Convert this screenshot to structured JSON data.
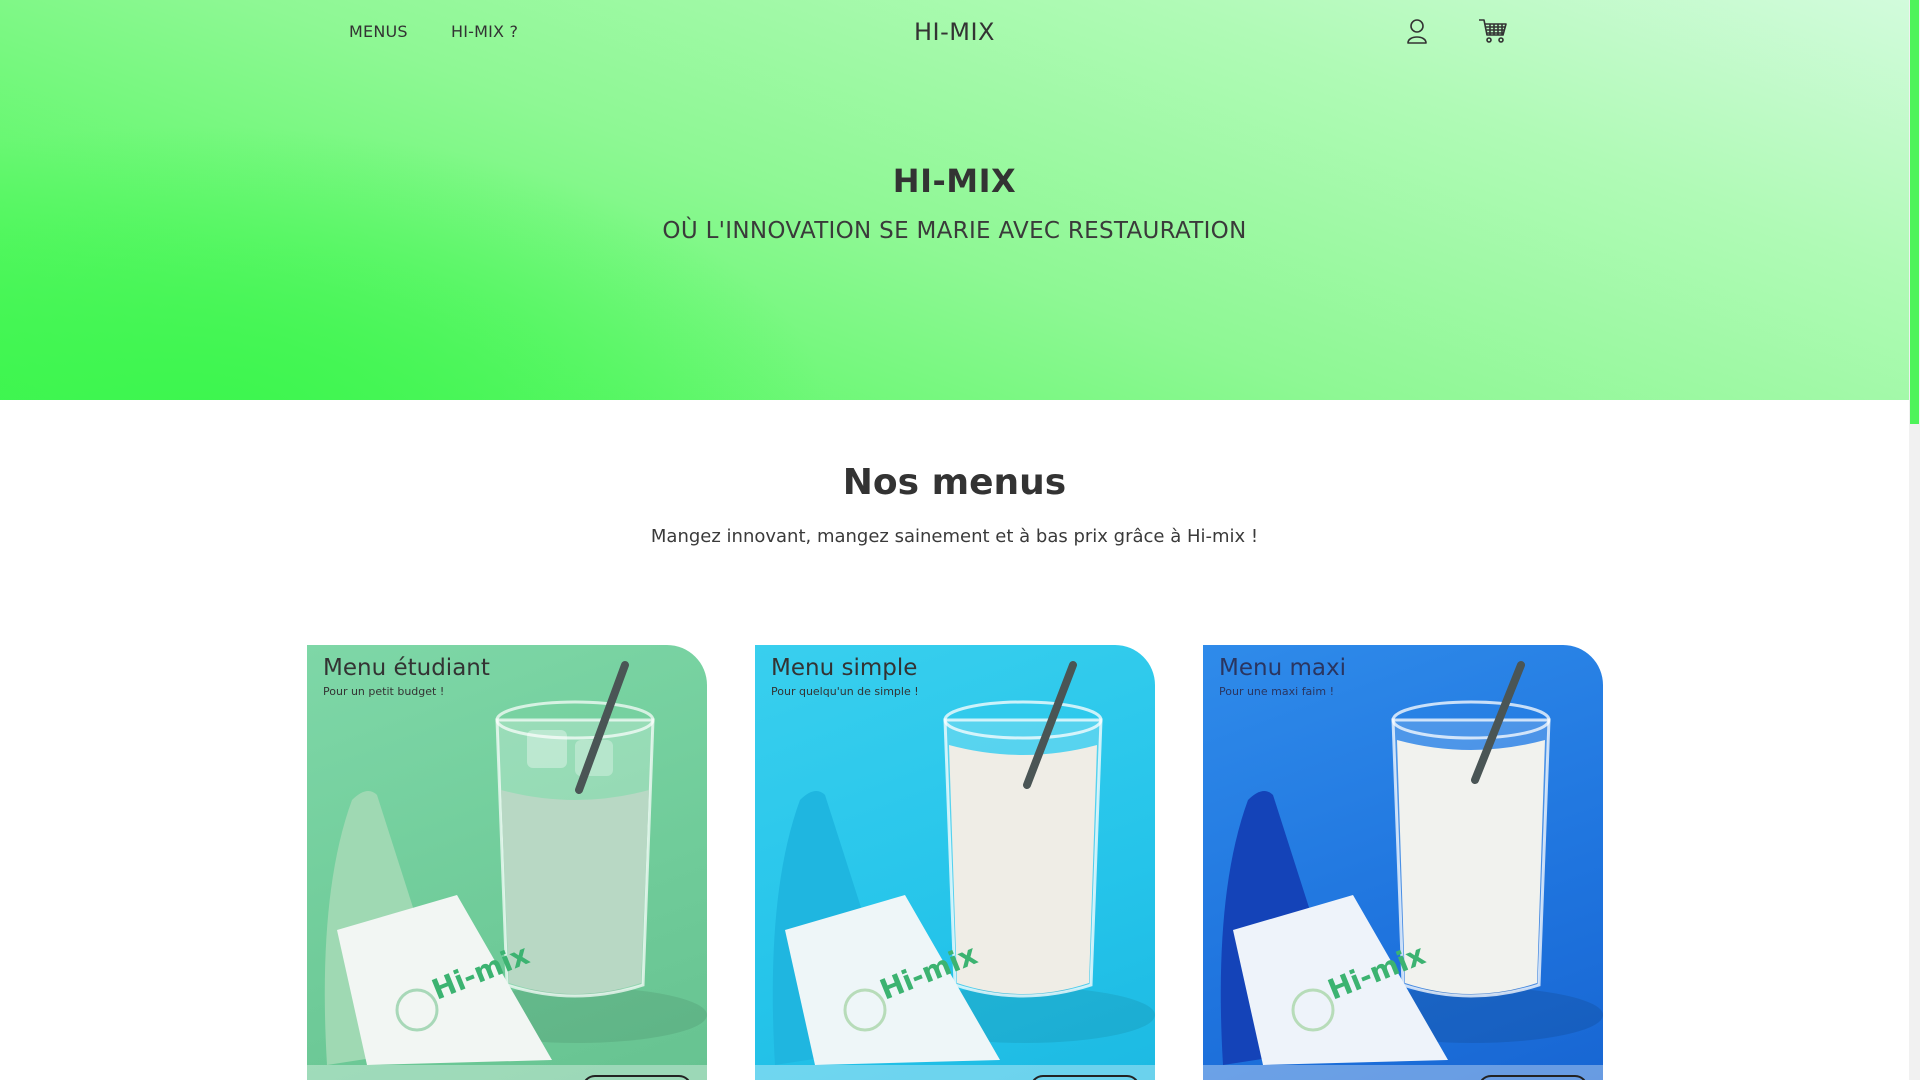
{
  "nav": {
    "links": [
      "MENUS",
      "HI-MIX ?"
    ],
    "brand": "HI-MIX",
    "icons": [
      "user-icon",
      "cart-icon"
    ]
  },
  "hero": {
    "title": "HI-MIX",
    "subtitle": "OÙ L'INNOVATION SE MARIE AVEC RESTAURATION",
    "colors": {
      "gradient_light": "#d2fbdc",
      "gradient_strong": "#3cf64e"
    }
  },
  "menus": {
    "title": "Nos menus",
    "subtitle": "Mangez innovant, mangez sainement et à bas prix grâce à Hi-mix !",
    "cards": [
      {
        "title": "Menu étudiant",
        "subtitle": "Pour un petit budget !",
        "bg": "#72cc9c",
        "pack_color": "#9fd9b3",
        "drink": "#b8d8c4"
      },
      {
        "title": "Menu simple",
        "subtitle": "Pour quelqu'un de simple !",
        "bg": "#2ac7eb",
        "pack_color": "#1fb6e0",
        "drink": "#efede6"
      },
      {
        "title": "Menu maxi",
        "subtitle": "Pour une maxi faim !",
        "bg": "#1f74de",
        "pack_color": "#1443b8",
        "drink": "#f1f2ee"
      }
    ],
    "pack_logo": "Hi-mix"
  },
  "scrollbar": {
    "thumb_color": "#4ef35a"
  }
}
